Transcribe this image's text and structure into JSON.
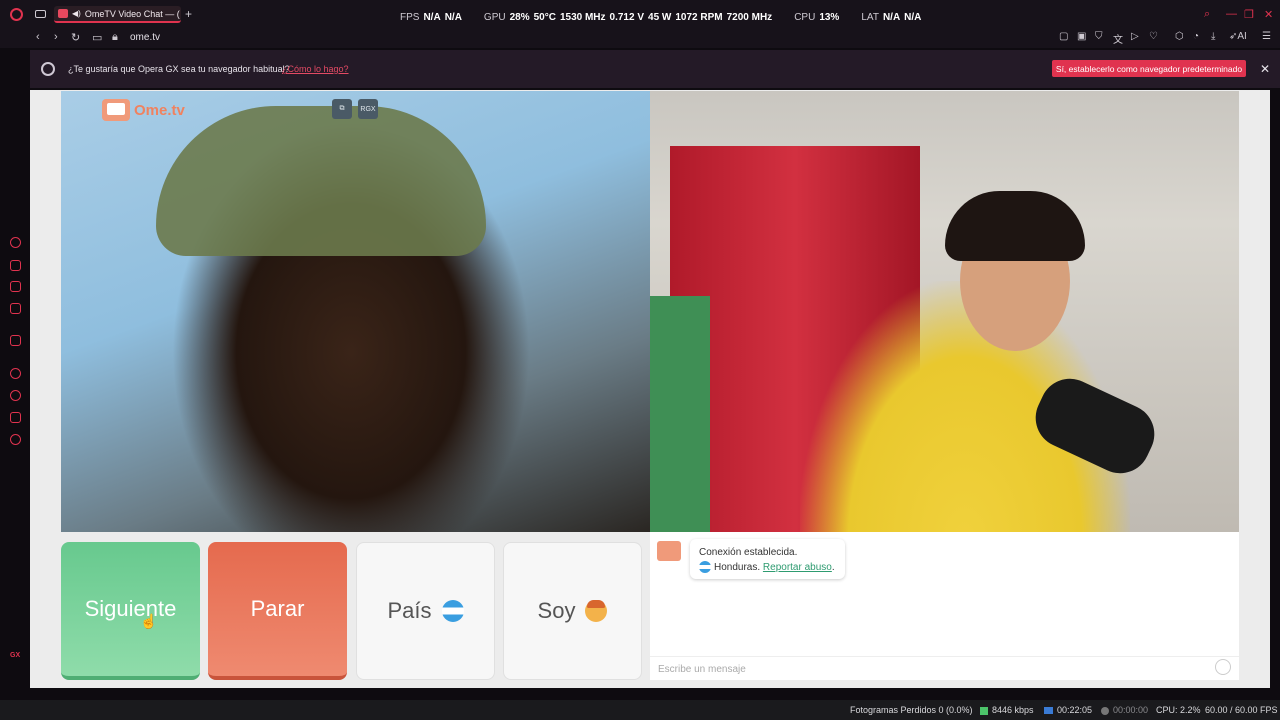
{
  "browser": {
    "tab_title": "OmeTV Video Chat — (",
    "url": "ome.tv",
    "metrics": {
      "fps_label": "FPS",
      "fps_values": [
        "N/A",
        "N/A"
      ],
      "gpu_label": "GPU",
      "gpu_load": "28%",
      "gpu_temp": "50°C",
      "gpu_clock": "1530 MHz",
      "gpu_volt": "0.712 V",
      "gpu_power": "45 W",
      "gpu_fan": "1072 RPM",
      "gpu_mem": "7200 MHz",
      "cpu_label": "CPU",
      "cpu_value": "13%",
      "lat_label": "LAT",
      "lat_values": [
        "N/A",
        "N/A"
      ]
    },
    "ai_label": "AI"
  },
  "notice": {
    "message": "¿Te gustaría que Opera GX sea tu navegador habitual?",
    "link": "¿Cómo lo hago?",
    "button": "Sí, establecerlo como navegador predeterminado"
  },
  "sidebar": {
    "gx_label": "GX"
  },
  "omegle": {
    "logo_text": "Ome.tv",
    "ctl_labels": [
      "⧉",
      "RGX"
    ],
    "buttons": {
      "next": "Siguiente",
      "stop": "Parar",
      "country": "País",
      "me": "Soy"
    },
    "chat": {
      "line1": "Conexión establecida.",
      "country": "Honduras.",
      "report": "Reportar abuso",
      "suffix": ".",
      "placeholder": "Escribe un mensaje"
    }
  },
  "status": {
    "dropped": "Fotogramas Perdidos 0 (0.0%)",
    "bitrate": "8446 kbps",
    "stream_time": "00:22:05",
    "rec_time": "00:00:00",
    "cpu": "CPU: 2.2%",
    "fps": "60.00 / 60.00 FPS"
  },
  "colors": {
    "accent": "#e0334f",
    "next": "#67c98e",
    "stop": "#e56a4e"
  }
}
